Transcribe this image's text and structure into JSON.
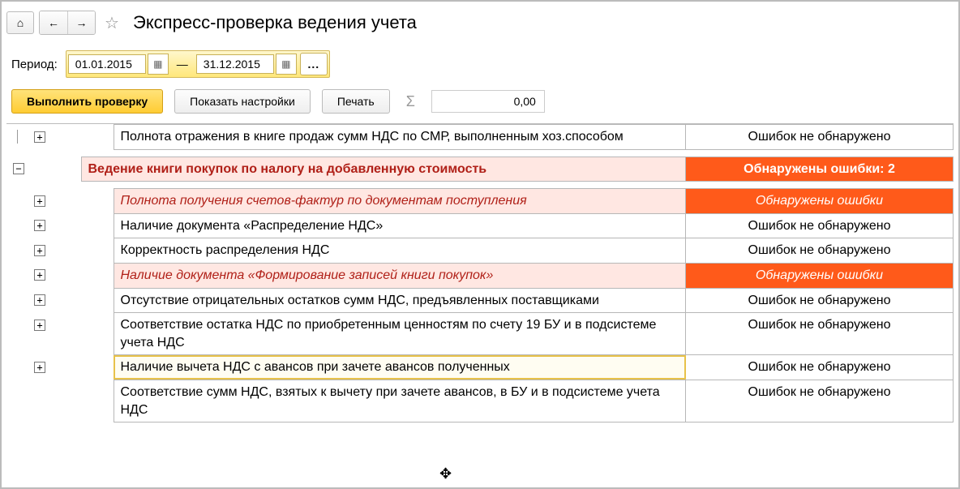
{
  "title": "Экспресс-проверка ведения учета",
  "period": {
    "label": "Период:",
    "from": "01.01.2015",
    "to": "31.12.2015",
    "dash": "—",
    "dots": "..."
  },
  "toolbar": {
    "run": "Выполнить проверку",
    "settings": "Показать настройки",
    "print": "Печать",
    "sigma": "Σ",
    "sum": "0,00"
  },
  "status": {
    "ok": "Ошибок не обнаружено",
    "err": "Обнаружены ошибки",
    "headErr": "Обнаружены ошибки: 2"
  },
  "rows": {
    "preTop": "Полнота отражения в книге продаж сумм НДС по СМР, выполненным хоз.способом",
    "group": "Ведение книги покупок по налогу на добавленную стоимость",
    "r1": "Полнота получения счетов-фактур по документам поступления",
    "r2": "Наличие документа «Распределение НДС»",
    "r3": "Корректность распределения НДС",
    "r4": "Наличие документа «Формирование записей книги покупок»",
    "r5": "Отсутствие отрицательных остатков сумм НДС, предъявленных поставщиками",
    "r6": "Соответствие остатка НДС по приобретенным ценностям по счету 19 БУ и в подсистеме учета НДС",
    "r7": "Наличие вычета НДС с авансов при зачете авансов полученных",
    "r8": "Соответствие сумм НДС, взятых к вычету при зачете авансов, в БУ и в подсистеме учета НДС"
  },
  "icons": {
    "home": "⌂",
    "back": "←",
    "fwd": "→",
    "star": "☆",
    "cal": "▦",
    "plus": "+",
    "minus": "−"
  }
}
